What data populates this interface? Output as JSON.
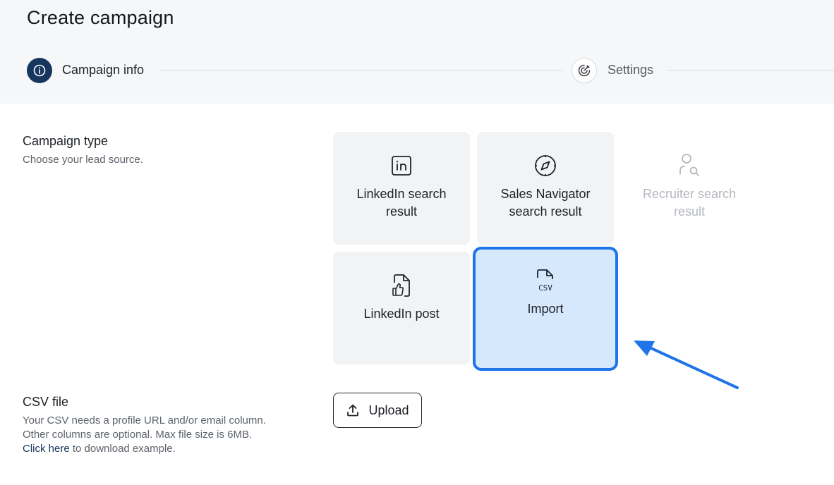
{
  "header": {
    "title": "Create campaign",
    "steps": [
      {
        "label": "Campaign info",
        "icon": "info-icon",
        "state": "active"
      },
      {
        "label": "Settings",
        "icon": "target-icon",
        "state": "inactive"
      }
    ]
  },
  "campaign_type": {
    "title": "Campaign type",
    "description": "Choose your lead source.",
    "options": [
      {
        "label": "LinkedIn search result",
        "icon": "linkedin-icon",
        "state": "default"
      },
      {
        "label": "Sales Navigator search result",
        "icon": "compass-icon",
        "state": "default"
      },
      {
        "label": "Recruiter search result",
        "icon": "person-search-icon",
        "state": "disabled"
      },
      {
        "label": "LinkedIn post",
        "icon": "thumbs-up-file-icon",
        "state": "default"
      },
      {
        "label": "Import",
        "icon": "csv-file-icon",
        "state": "selected"
      }
    ]
  },
  "csv_file": {
    "title": "CSV file",
    "desc_line1": "Your CSV needs a profile URL and/or email column.",
    "desc_line2": "Other columns are optional. Max file size is 6MB.",
    "link_text": "Click here",
    "link_suffix": " to download example.",
    "upload_label": "Upload"
  },
  "colors": {
    "primary": "#17365d",
    "selected_border": "#1f74e8",
    "selected_fill": "#d6e8fc",
    "tile_bg": "#f2f3f5",
    "annotation_arrow": "#1f74e8"
  }
}
